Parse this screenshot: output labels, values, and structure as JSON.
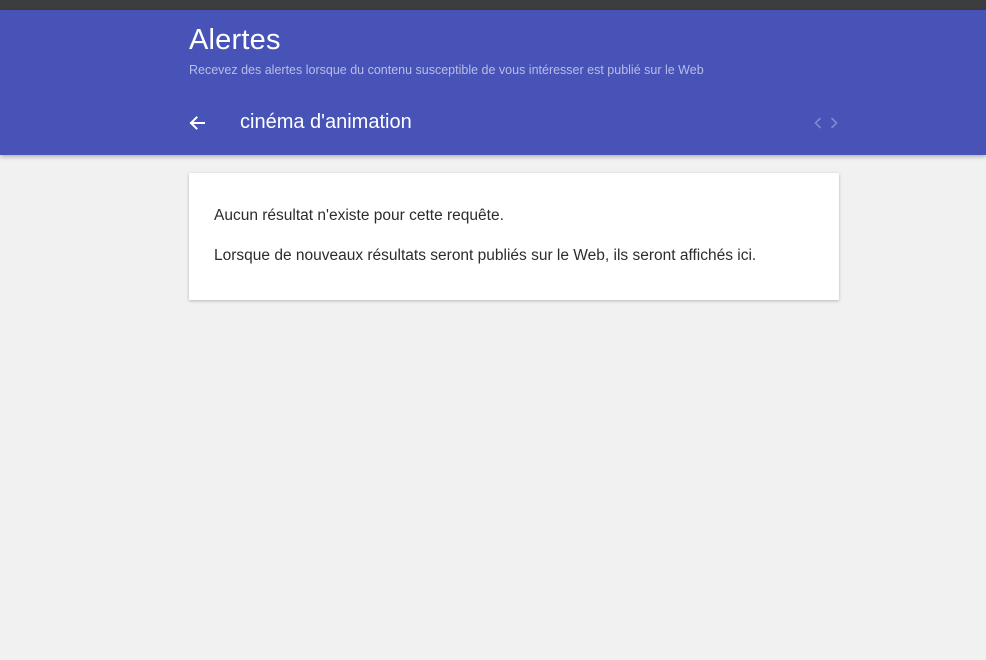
{
  "header": {
    "title": "Alertes",
    "subtitle": "Recevez des alertes lorsque du contenu susceptible de vous intéresser est publié sur le Web",
    "query": "cinéma d'animation",
    "accent_color": "#4753b7"
  },
  "icons": {
    "back": "arrow-back-icon",
    "previous": "chevron-left-icon",
    "next": "chevron-right-icon"
  },
  "results": {
    "empty_message": "Aucun résultat n'existe pour cette requête.",
    "info_message": "Lorsque de nouveaux résultats seront publiés sur le Web, ils seront affichés ici."
  }
}
